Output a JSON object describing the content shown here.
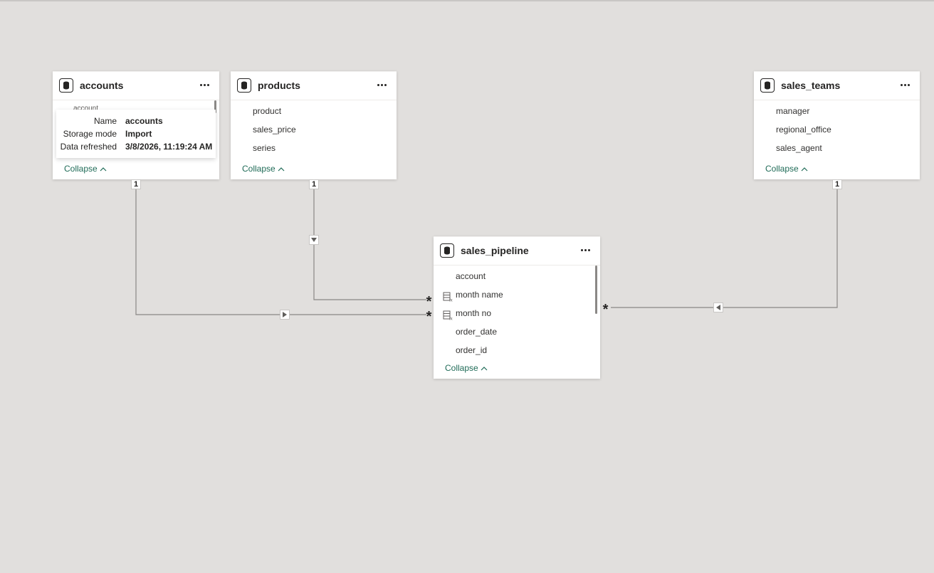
{
  "tables": {
    "accounts": {
      "title": "accounts",
      "peek_text": "account",
      "collapse_label": "Collapse"
    },
    "products": {
      "title": "products",
      "fields": [
        "product",
        "sales_price",
        "series"
      ],
      "collapse_label": "Collapse"
    },
    "sales_teams": {
      "title": "sales_teams",
      "fields": [
        "manager",
        "regional_office",
        "sales_agent"
      ],
      "collapse_label": "Collapse"
    },
    "sales_pipeline": {
      "title": "sales_pipeline",
      "fields": [
        "account",
        "month name",
        "month no",
        "order_date",
        "order_id"
      ],
      "collapse_label": "Collapse"
    }
  },
  "tooltip": {
    "name_label": "Name",
    "name_value": "accounts",
    "storage_label": "Storage mode",
    "storage_value": "Import",
    "refreshed_label": "Data refreshed",
    "refreshed_value": "3/8/2026, 11:19:24 AM"
  },
  "relationships": {
    "one": "1",
    "many": "*"
  },
  "icons": {
    "table": "table-db-icon",
    "more": "more-options-icon",
    "calculated_column": "calculated-column-icon",
    "chevron": "chevron-up-icon",
    "filter_direction": "triangle-arrow-icon"
  },
  "colors": {
    "canvas": "#e1dfdd",
    "accent": "#1f6b57",
    "line": "#8a8886"
  }
}
